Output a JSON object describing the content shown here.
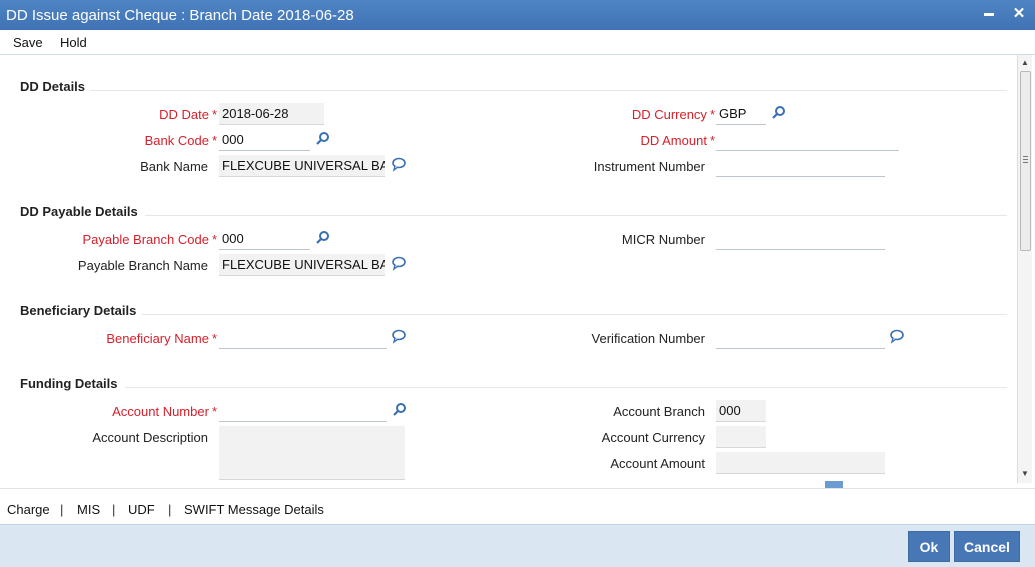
{
  "window": {
    "title": "DD Issue against Cheque : Branch Date 2018-06-28",
    "minimize_glyph": "▬",
    "close_glyph": "✕"
  },
  "toolbar": {
    "save_label": "Save",
    "hold_label": "Hold"
  },
  "sections": {
    "dd_details": "DD Details",
    "dd_payable_details": "DD Payable Details",
    "beneficiary_details": "Beneficiary Details",
    "funding_details": "Funding Details"
  },
  "dd_details": {
    "dd_date_label": "DD Date",
    "dd_date_value": "2018-06-28",
    "bank_code_label": "Bank Code",
    "bank_code_value": "000",
    "bank_name_label": "Bank Name",
    "bank_name_value": "FLEXCUBE UNIVERSAL BA",
    "dd_currency_label": "DD Currency",
    "dd_currency_value": "GBP",
    "dd_amount_label": "DD Amount",
    "dd_amount_value": "",
    "instrument_number_label": "Instrument Number",
    "instrument_number_value": ""
  },
  "dd_payable": {
    "payable_branch_code_label": "Payable Branch Code",
    "payable_branch_code_value": "000",
    "payable_branch_name_label": "Payable Branch Name",
    "payable_branch_name_value": "FLEXCUBE UNIVERSAL BA",
    "micr_number_label": "MICR Number",
    "micr_number_value": ""
  },
  "beneficiary": {
    "beneficiary_name_label": "Beneficiary Name",
    "beneficiary_name_value": "",
    "verification_number_label": "Verification Number",
    "verification_number_value": ""
  },
  "funding": {
    "account_number_label": "Account Number",
    "account_number_value": "",
    "account_description_label": "Account Description",
    "account_description_value": "",
    "account_branch_label": "Account Branch",
    "account_branch_value": "000",
    "account_currency_label": "Account Currency",
    "account_currency_value": "",
    "account_amount_label": "Account Amount",
    "account_amount_value": ""
  },
  "required_marker": "*",
  "footer_links": {
    "charge": "Charge",
    "mis": "MIS",
    "udf": "UDF",
    "swift": "SWIFT Message Details",
    "separator": "|"
  },
  "buttons": {
    "ok": "Ok",
    "cancel": "Cancel"
  },
  "colors": {
    "titlebar": "#4a7fc1",
    "required": "#d6202b",
    "icon": "#3a6fb3",
    "button": "#4877b6",
    "bottombar": "#dbe6f3"
  }
}
